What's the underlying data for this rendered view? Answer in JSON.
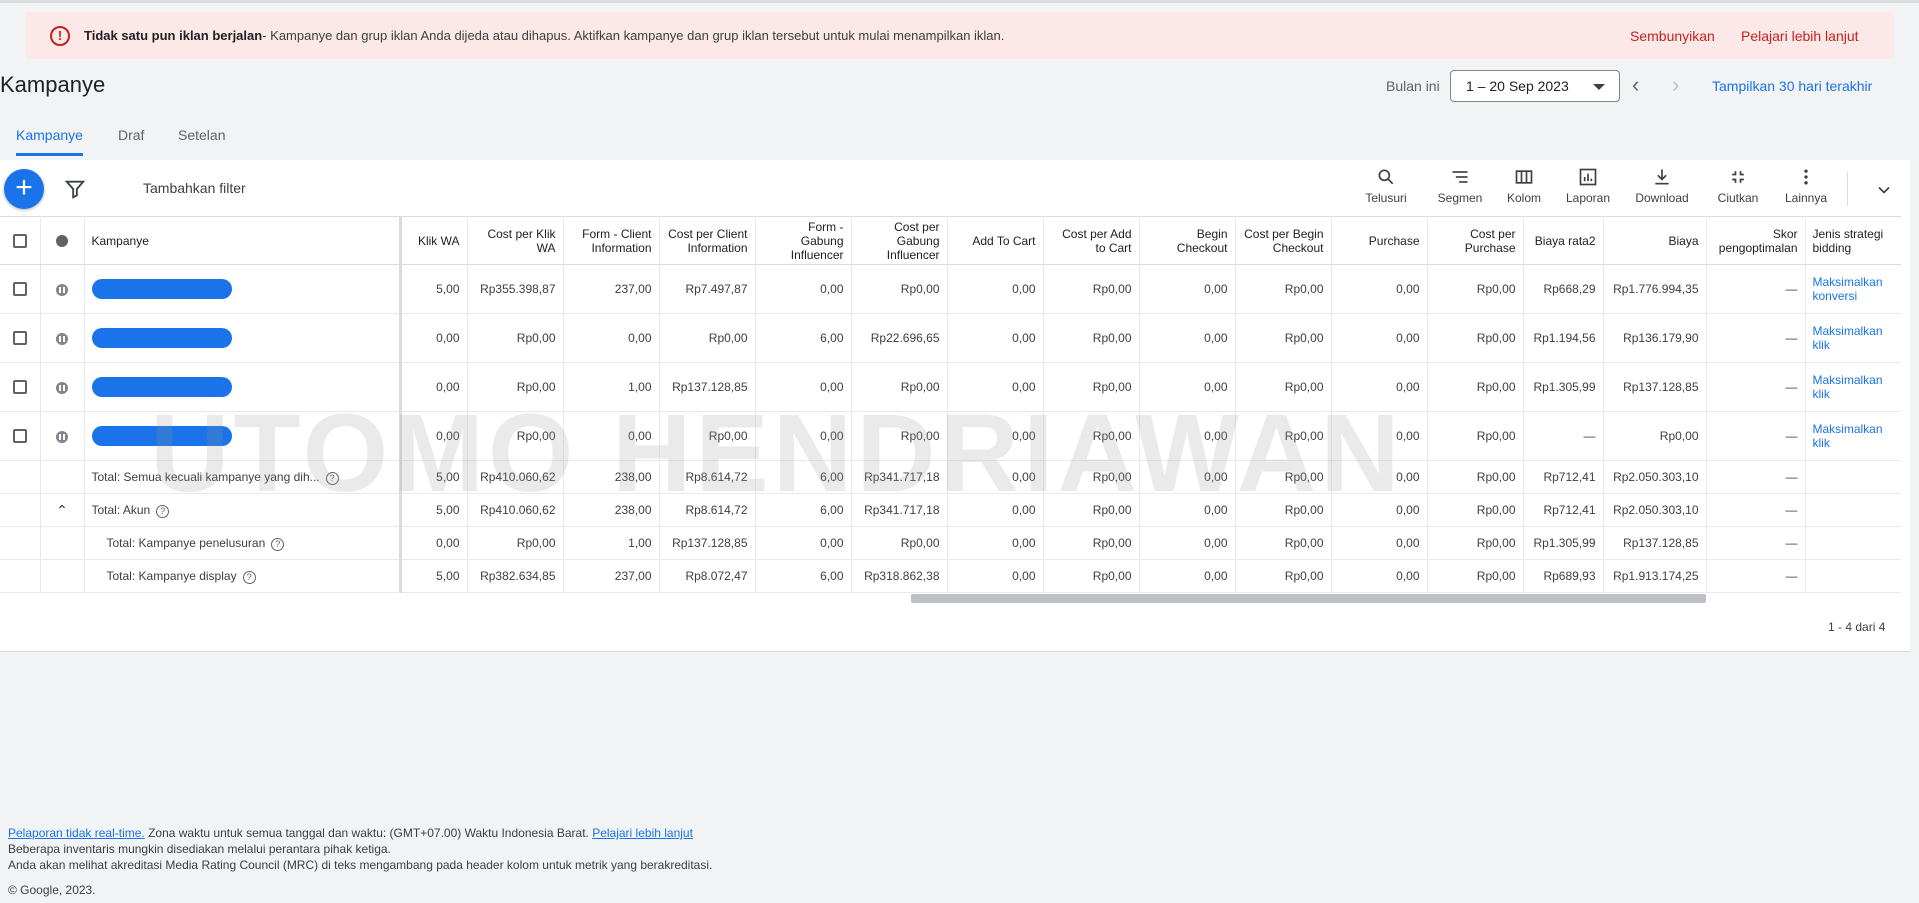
{
  "alert": {
    "icon": "error-icon",
    "bold_text": "Tidak satu pun iklan berjalan",
    "message": " - Kampanye dan grup iklan Anda dijeda atau dihapus. Aktifkan kampanye dan grup iklan tersebut untuk mulai menampilkan iklan.",
    "hide_label": "Sembunyikan",
    "learn_label": "Pelajari lebih lanjut"
  },
  "header": {
    "title": "Kampanye",
    "date_label": "Bulan ini",
    "date_range": "1 – 20 Sep 2023",
    "show_last_30": "Tampilkan 30 hari terakhir"
  },
  "tabs": [
    {
      "label": "Kampanye",
      "active": true
    },
    {
      "label": "Draf",
      "active": false
    },
    {
      "label": "Setelan",
      "active": false
    }
  ],
  "toolbar": {
    "add_filter": "Tambahkan filter",
    "tools": [
      "Telusuri",
      "Segmen",
      "Kolom",
      "Laporan",
      "Download",
      "Ciutkan",
      "Lainnya"
    ]
  },
  "table": {
    "campaign_header": "Kampanye",
    "columns": [
      "Klik WA",
      "Cost per Klik WA",
      "Form - Client Information",
      "Cost per Client Information",
      "Form - Gabung Influencer",
      "Cost per Gabung Influencer",
      "Add To Cart",
      "Cost per Add to Cart",
      "Begin Checkout",
      "Cost per Begin Checkout",
      "Purchase",
      "Cost per Purchase",
      "Biaya rata2",
      "Biaya",
      "Skor pengoptimalan",
      "Jenis strategi bidding"
    ],
    "rows": [
      {
        "values": [
          "5,00",
          "Rp355.398,87",
          "237,00",
          "Rp7.497,87",
          "0,00",
          "Rp0,00",
          "0,00",
          "Rp0,00",
          "0,00",
          "Rp0,00",
          "0,00",
          "Rp0,00",
          "Rp668,29",
          "Rp1.776.994,35",
          "—"
        ],
        "bidding": "Maksimalkan konversi"
      },
      {
        "values": [
          "0,00",
          "Rp0,00",
          "0,00",
          "Rp0,00",
          "6,00",
          "Rp22.696,65",
          "0,00",
          "Rp0,00",
          "0,00",
          "Rp0,00",
          "0,00",
          "Rp0,00",
          "Rp1.194,56",
          "Rp136.179,90",
          "—"
        ],
        "bidding": "Maksimalkan klik"
      },
      {
        "values": [
          "0,00",
          "Rp0,00",
          "1,00",
          "Rp137.128,85",
          "0,00",
          "Rp0,00",
          "0,00",
          "Rp0,00",
          "0,00",
          "Rp0,00",
          "0,00",
          "Rp0,00",
          "Rp1.305,99",
          "Rp137.128,85",
          "—"
        ],
        "bidding": "Maksimalkan klik"
      },
      {
        "values": [
          "0,00",
          "Rp0,00",
          "0,00",
          "Rp0,00",
          "0,00",
          "Rp0,00",
          "0,00",
          "Rp0,00",
          "0,00",
          "Rp0,00",
          "0,00",
          "Rp0,00",
          "—",
          "Rp0,00",
          "—"
        ],
        "bidding": "Maksimalkan klik"
      }
    ],
    "totals": [
      {
        "label": "Total: Semua kecuali kampanye yang dih...",
        "values": [
          "5,00",
          "Rp410.060,62",
          "238,00",
          "Rp8.614,72",
          "6,00",
          "Rp341.717,18",
          "0,00",
          "Rp0,00",
          "0,00",
          "Rp0,00",
          "0,00",
          "Rp0,00",
          "Rp712,41",
          "Rp2.050.303,10",
          "—"
        ]
      },
      {
        "label": "Total: Akun",
        "values": [
          "5,00",
          "Rp410.060,62",
          "238,00",
          "Rp8.614,72",
          "6,00",
          "Rp341.717,18",
          "0,00",
          "Rp0,00",
          "0,00",
          "Rp0,00",
          "0,00",
          "Rp0,00",
          "Rp712,41",
          "Rp2.050.303,10",
          "—"
        ]
      },
      {
        "label": "Total: Kampanye penelusuran",
        "values": [
          "0,00",
          "Rp0,00",
          "1,00",
          "Rp137.128,85",
          "0,00",
          "Rp0,00",
          "0,00",
          "Rp0,00",
          "0,00",
          "Rp0,00",
          "0,00",
          "Rp0,00",
          "Rp1.305,99",
          "Rp137.128,85",
          "—"
        ]
      },
      {
        "label": "Total: Kampanye display",
        "values": [
          "5,00",
          "Rp382.634,85",
          "237,00",
          "Rp8.072,47",
          "6,00",
          "Rp318.862,38",
          "0,00",
          "Rp0,00",
          "0,00",
          "Rp0,00",
          "0,00",
          "Rp0,00",
          "Rp689,93",
          "Rp1.913.174,25",
          "—"
        ]
      }
    ],
    "pager": "1 - 4 dari 4"
  },
  "watermark": "UTOMO HENDRIAWAN",
  "footer": {
    "link1": "Pelaporan tidak real-time.",
    "line1": " Zona waktu untuk semua tanggal dan waktu: (GMT+07.00) Waktu Indonesia Barat. ",
    "link2": "Pelajari lebih lanjut",
    "line2": "Beberapa inventaris mungkin disediakan melalui perantara pihak ketiga.",
    "line3": "Anda akan melihat akreditasi Media Rating Council (MRC) di teks mengambang pada header kolom untuk metrik yang berakreditasi.",
    "copyright": "© Google, 2023."
  },
  "colors": {
    "accent": "#1a73e8",
    "alert_bg": "#fce8e6",
    "alert_text": "#c5221f"
  }
}
